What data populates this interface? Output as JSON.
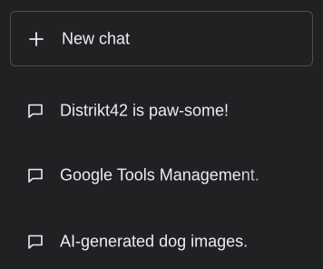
{
  "new_chat": {
    "label": "New chat",
    "icon": "plus-icon"
  },
  "history": [
    {
      "label": "Distrikt42 is paw-some!",
      "icon": "chat-bubble-icon"
    },
    {
      "label": "Google Tools Management.",
      "icon": "chat-bubble-icon"
    },
    {
      "label": "AI-generated dog images.",
      "icon": "chat-bubble-icon"
    }
  ],
  "colors": {
    "background": "#202123",
    "border": "#4d4d4f",
    "text": "#ececf1"
  }
}
